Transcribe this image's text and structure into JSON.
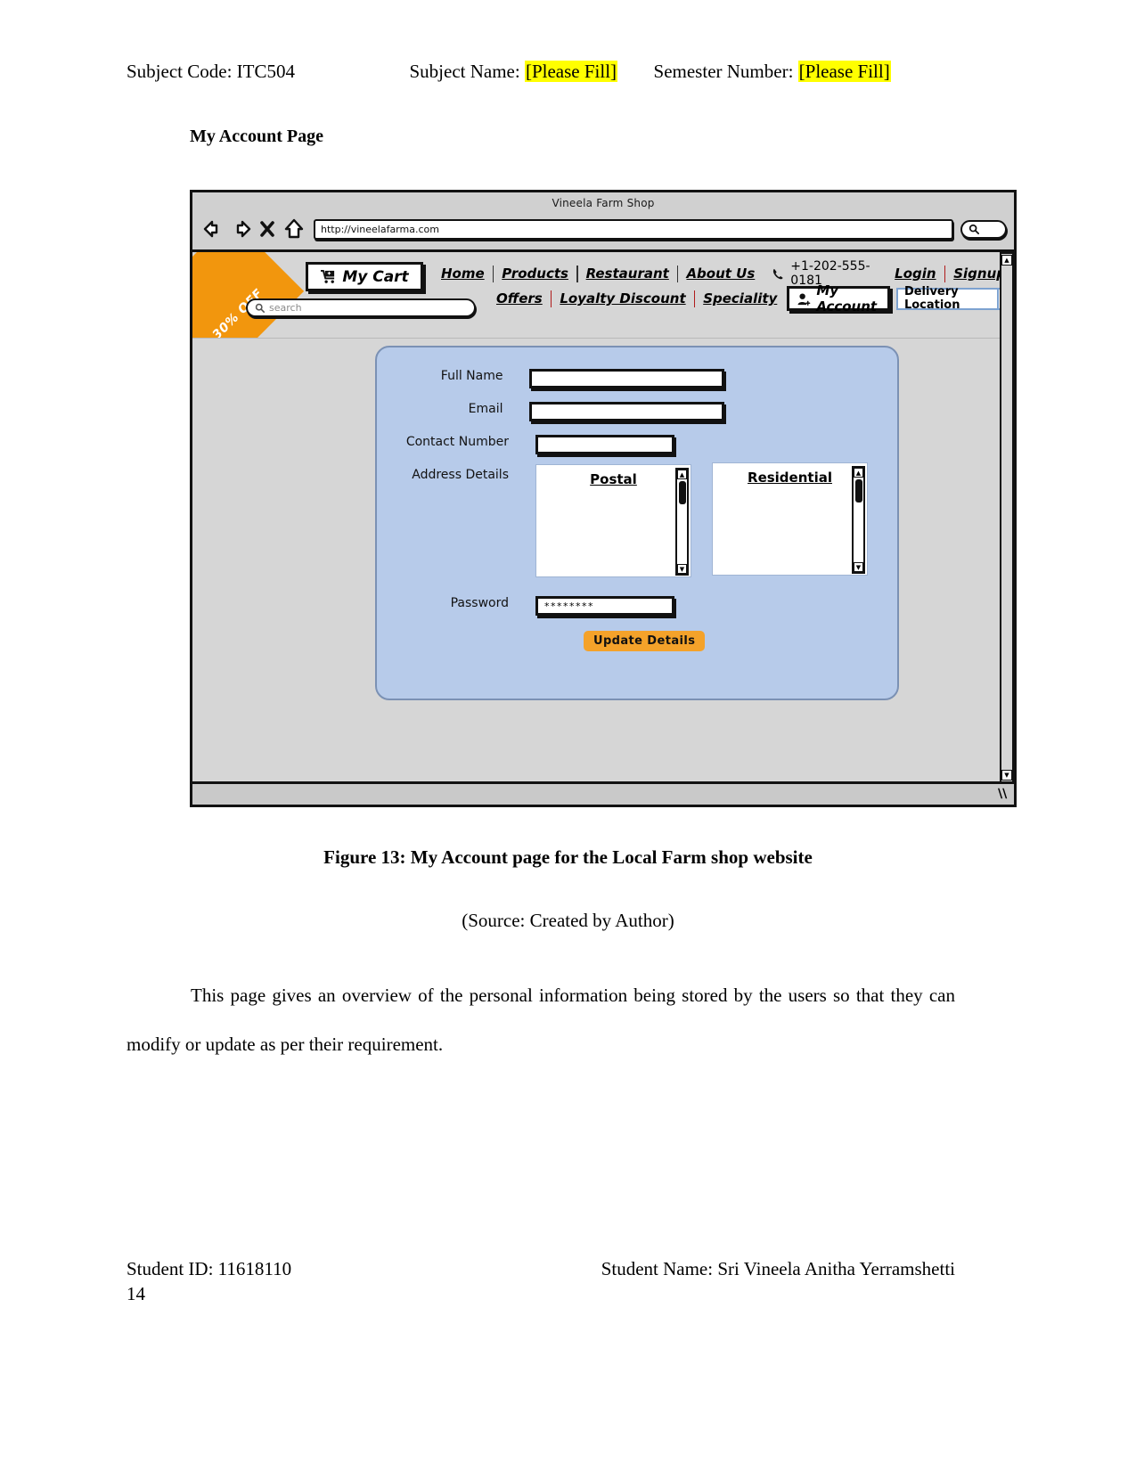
{
  "doc_header": {
    "subject_code_label": "Subject Code: ITC504",
    "subject_name_label": "Subject Name:",
    "subject_name_value": "[Please Fill]",
    "semester_label": "Semester Number:",
    "semester_value": "[Please Fill]"
  },
  "page_subtitle": "My Account Page",
  "browser": {
    "window_title": "Vineela Farm Shop",
    "url": "http://vineelafarma.com",
    "back_icon": "back-arrow-icon",
    "forward_icon": "forward-arrow-icon",
    "stop_icon": "close-x-icon",
    "home_icon": "home-icon",
    "go_icon": "search-icon"
  },
  "site_header": {
    "ribbon_text": "30% OFF",
    "cart_label": "My Cart",
    "cart_icon": "shopping-cart-icon",
    "search_placeholder": "search",
    "search_icon": "search-icon",
    "nav_row_1": [
      "Home",
      "Products",
      "Restaurant",
      "About Us"
    ],
    "phone_icon": "phone-icon",
    "phone": "+1-202-555-0181",
    "login": "Login",
    "signup": "Signup",
    "nav_row_2": [
      "Offers",
      "Loyalty Discount",
      "Speciality"
    ],
    "my_account_label": "My Account",
    "my_account_icon": "user-add-icon",
    "delivery_location_label": "Delivery Location",
    "delivery_caret_icon": "chevron-down-icon"
  },
  "form": {
    "fields": [
      {
        "label": "Full Name",
        "value": ""
      },
      {
        "label": "Email",
        "value": ""
      },
      {
        "label": "Contact Number",
        "value": ""
      }
    ],
    "address_label": "Address Details",
    "address_boxes": [
      {
        "title": "Postal",
        "value": ""
      },
      {
        "title": "Residential",
        "value": ""
      }
    ],
    "password_label": "Password",
    "password_value": "********",
    "submit_label": "Update Details"
  },
  "figure": {
    "caption": "Figure 13: My Account page for the Local Farm shop website",
    "source": "(Source: Created by Author)"
  },
  "body_text": "This page gives an overview of the personal information being stored by the users so that they can modify or update as per their requirement.",
  "footer": {
    "student_id": "Student ID: 11618110",
    "student_name": "Student Name: Sri Vineela Anitha Yerramshetti",
    "page_number": "14"
  },
  "colors": {
    "highlight": "#ffff00",
    "ribbon": "#f2960d",
    "panel": "#b7cbea",
    "button": "#f4a22a",
    "divider_red": "#b01b1b"
  }
}
